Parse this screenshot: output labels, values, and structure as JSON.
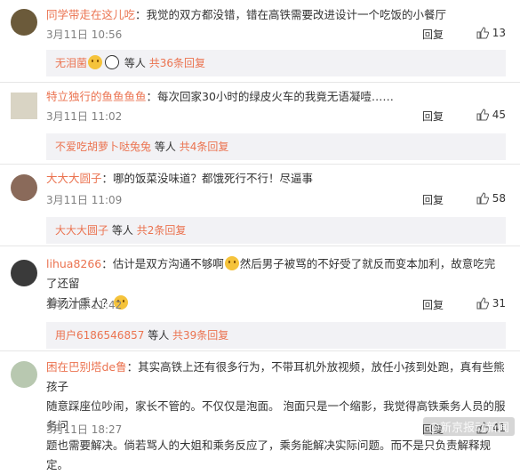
{
  "comments": [
    {
      "user": "同学带走在这儿吃",
      "text": "：我觉的双方都没错，错在高铁需要改进设计一个吃饭的小餐厅",
      "time": "3月11日 10:56",
      "reply": "回复",
      "likes": "13",
      "sub_user": "无泪菌",
      "sub_mid": "等人",
      "sub_count": "共36条回复"
    },
    {
      "user": "特立独行的鱼鱼鱼鱼",
      "text": "：每次回家30小时的绿皮火车的我竟无语凝噎……",
      "time": "3月11日 11:02",
      "reply": "回复",
      "likes": "45",
      "sub_user": "不爱吃胡萝卜哒兔兔",
      "sub_mid": "等人",
      "sub_count": "共4条回复"
    },
    {
      "user": "大大大圆子",
      "text": "：哪的饭菜没味道？都饿死行不行！尽逼事",
      "time": "3月11日 11:09",
      "reply": "回复",
      "likes": "58",
      "sub_user": "大大大圆子",
      "sub_mid": "等人",
      "sub_count": "共2条回复"
    },
    {
      "user": "lihua8266",
      "text1": "：估计是双方沟通不够啊",
      "text2": "然后男子被骂的不好受了就反而变本加利，故意吃完了还留",
      "text3": "着汤汁熏人？",
      "time": "3月11日 11:42",
      "reply": "回复",
      "likes": "31",
      "sub_user": "用户6186546857",
      "sub_mid": "等人",
      "sub_count": "共39条回复"
    },
    {
      "user": "困在巴别塔de鲁",
      "text1": "：其实高铁上还有很多行为，不带耳机外放视频，放任小孩到处跑，真有些熊孩子",
      "text2": "随意踩座位吵闹，家长不管的。不仅仅是泡面。 泡面只是一个缩影，我觉得高铁乘务人员的服务问",
      "text3": "题也需要解决。倘若骂人的大姐和乘务反应了，乘务能解决实际问题。而不是只负责解释规定。",
      "time": "3月11日 18:27",
      "reply": "回复",
      "likes": "41"
    }
  ],
  "watermark": "@新京报动新闻"
}
